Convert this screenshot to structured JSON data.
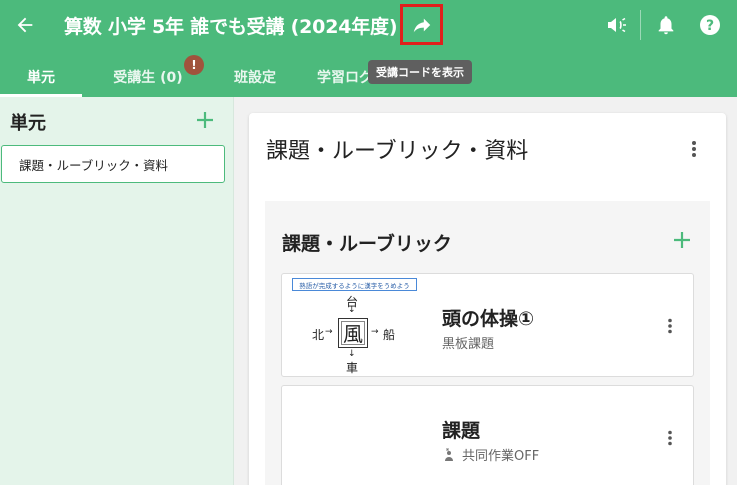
{
  "header": {
    "title": "算数 小学 5年 誰でも受講 (2024年度)",
    "icons": [
      "arrow-left-icon",
      "share-icon",
      "megaphone-icon",
      "bell-icon",
      "help-icon"
    ],
    "tooltip": "受講コードを表示"
  },
  "tabs": [
    {
      "label": "単元"
    },
    {
      "label": "受講生 (0)"
    },
    {
      "label": "班設定"
    },
    {
      "label": "学習ログ"
    }
  ],
  "badge": "!",
  "sidebar": {
    "title": "単元",
    "items": [
      {
        "label": "課題・ルーブリック・資料"
      }
    ]
  },
  "main": {
    "title": "課題・ルーブリック・資料",
    "section_title": "課題・ルーブリック",
    "items": [
      {
        "title": "頭の体操①",
        "subtitle": "黒板課題",
        "thumbnail": {
          "banner": "熟語が完成するように漢字をうめよう",
          "center": "風",
          "top": "台",
          "left": "北",
          "right": "船",
          "bottom": "車",
          "arrow_down": "↓",
          "arrow_right": "→"
        }
      },
      {
        "title": "課題",
        "subtitle": "共同作業OFF"
      }
    ]
  },
  "colors": {
    "primary": "#4cba7c",
    "badge": "#a0533c",
    "highlight": "#e0201c",
    "tooltip_bg": "#5f5f5f",
    "sidebar_bg": "#e4f4ea"
  }
}
